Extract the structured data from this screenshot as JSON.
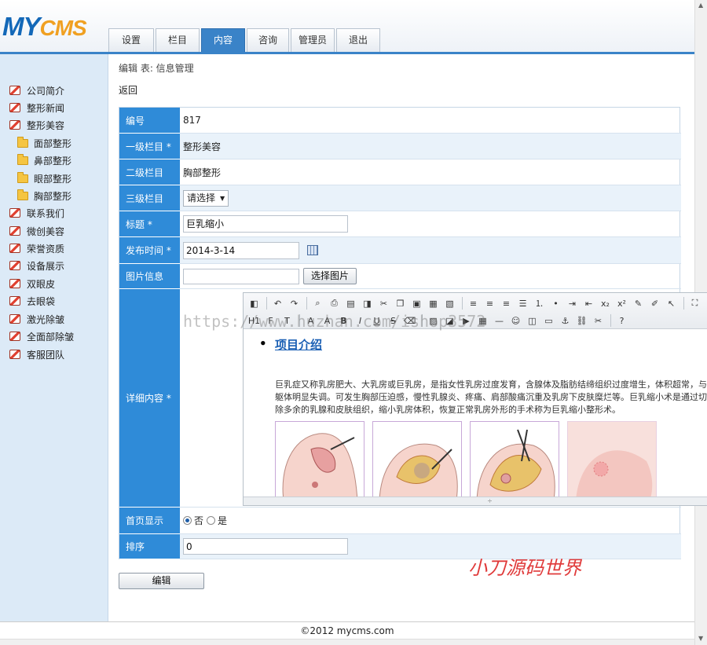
{
  "logo": {
    "part1": "MY",
    "part2": "CMS"
  },
  "nav": {
    "tabs": [
      {
        "label": "设置"
      },
      {
        "label": "栏目"
      },
      {
        "label": "内容"
      },
      {
        "label": "咨询"
      },
      {
        "label": "管理员"
      },
      {
        "label": "退出"
      }
    ],
    "active_tab": "内容",
    "accent_color": "#3a83c8"
  },
  "sidebar": {
    "items": [
      {
        "label": "公司简介",
        "icon": "picture-icon"
      },
      {
        "label": "整形新闻",
        "icon": "picture-icon"
      },
      {
        "label": "整形美容",
        "icon": "picture-icon"
      },
      {
        "label": "面部整形",
        "icon": "folder-icon"
      },
      {
        "label": "鼻部整形",
        "icon": "folder-icon"
      },
      {
        "label": "眼部整形",
        "icon": "folder-icon"
      },
      {
        "label": "胸部整形",
        "icon": "folder-icon"
      },
      {
        "label": "联系我们",
        "icon": "picture-icon"
      },
      {
        "label": "微创美容",
        "icon": "picture-icon"
      },
      {
        "label": "荣誉资质",
        "icon": "picture-icon"
      },
      {
        "label": "设备展示",
        "icon": "picture-icon"
      },
      {
        "label": "双眼皮",
        "icon": "picture-icon"
      },
      {
        "label": "去眼袋",
        "icon": "picture-icon"
      },
      {
        "label": "激光除皱",
        "icon": "picture-icon"
      },
      {
        "label": "全面部除皱",
        "icon": "picture-icon"
      },
      {
        "label": "客服团队",
        "icon": "picture-icon"
      }
    ]
  },
  "main": {
    "breadcrumb": "编辑 表: 信息管理",
    "back_label": "返回"
  },
  "form": {
    "id": {
      "label": "编号",
      "value": "817"
    },
    "category1": {
      "label": "一级栏目 *",
      "value": "整形美容"
    },
    "category2": {
      "label": "二级栏目",
      "value": "胸部整形"
    },
    "category3": {
      "label": "三级栏目",
      "selected": "请选择"
    },
    "title": {
      "label": "标题 *",
      "value": "巨乳缩小"
    },
    "publish_time": {
      "label": "发布时间 *",
      "value": "2014-3-14"
    },
    "image": {
      "label": "图片信息",
      "value": "",
      "button": "选择图片"
    },
    "content": {
      "label": "详细内容 *",
      "heading": "项目介绍",
      "paragraph": "巨乳症又称乳房肥大、大乳房或巨乳房，是指女性乳房过度发育，含腺体及脂肪结缔组织过度增生，体积超常，与躯体明显失调。可发生胸部压迫感，慢性乳腺炎、疼痛、肩部酸痛沉重及乳房下皮肤糜烂等。巨乳缩小术是通过切除多余的乳腺和皮肤组织，缩小乳房体积，恢复正常乳房外形的手术称为巨乳缩小整形术。"
    },
    "homepage": {
      "label": "首页显示",
      "options": [
        "否",
        "是"
      ],
      "selected": "否"
    },
    "sort": {
      "label": "排序",
      "value": "0"
    },
    "submit_label": "编辑"
  },
  "watermark": "https://www.huzhan.com/ishop3572",
  "stamp": "小刀源码世界",
  "footer": "©2012 mycms.com"
}
